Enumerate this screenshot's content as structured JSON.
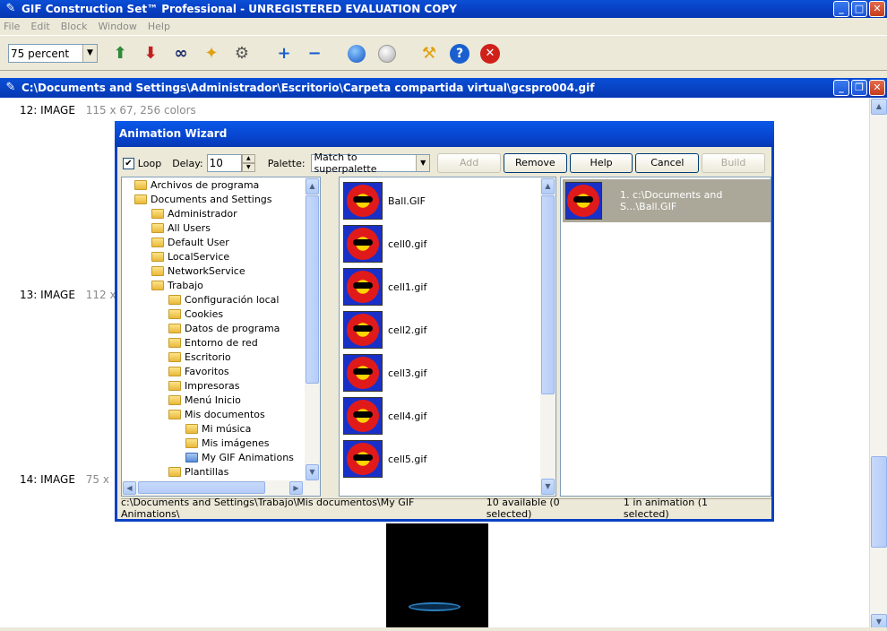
{
  "app": {
    "title": "GIF Construction Set™ Professional - UNREGISTERED EVALUATION COPY"
  },
  "menu": [
    "File",
    "Edit",
    "Block",
    "Window",
    "Help"
  ],
  "toolbar": {
    "zoom_value": "75 percent",
    "icons": [
      "insert-icon",
      "export-icon",
      "binoculars-icon",
      "wand-icon",
      "gear-icon",
      "zoom-in-icon",
      "zoom-out-icon",
      "play-icon",
      "stop-icon",
      "wrench-icon",
      "help-icon",
      "close-icon"
    ]
  },
  "document": {
    "title": "C:\\Documents and Settings\\Administrador\\Escritorio\\Carpeta compartida virtual\\gcspro004.gif",
    "blocks": [
      {
        "label": "12: IMAGE",
        "info": "115 x 67, 256 colors"
      },
      {
        "label": "13: IMAGE",
        "info": "112 x"
      },
      {
        "label": "14: IMAGE",
        "info": "75 x"
      }
    ]
  },
  "wizard": {
    "title": "Animation Wizard",
    "loop_label": "Loop",
    "loop_checked": true,
    "delay_label": "Delay:",
    "delay_value": "10",
    "palette_label": "Palette:",
    "palette_value": "Match to superpalette",
    "buttons": {
      "add": "Add",
      "remove": "Remove",
      "help": "Help",
      "cancel": "Cancel",
      "build": "Build"
    },
    "tree": [
      {
        "label": "Archivos de programa",
        "depth": 0
      },
      {
        "label": "Documents and Settings",
        "depth": 0
      },
      {
        "label": "Administrador",
        "depth": 1
      },
      {
        "label": "All Users",
        "depth": 1
      },
      {
        "label": "Default User",
        "depth": 1
      },
      {
        "label": "LocalService",
        "depth": 1
      },
      {
        "label": "NetworkService",
        "depth": 1
      },
      {
        "label": "Trabajo",
        "depth": 1
      },
      {
        "label": "Configuración local",
        "depth": 2
      },
      {
        "label": "Cookies",
        "depth": 2
      },
      {
        "label": "Datos de programa",
        "depth": 2
      },
      {
        "label": "Entorno de red",
        "depth": 2
      },
      {
        "label": "Escritorio",
        "depth": 2
      },
      {
        "label": "Favoritos",
        "depth": 2
      },
      {
        "label": "Impresoras",
        "depth": 2
      },
      {
        "label": "Menú Inicio",
        "depth": 2
      },
      {
        "label": "Mis documentos",
        "depth": 2
      },
      {
        "label": "Mi música",
        "depth": 3
      },
      {
        "label": "Mis imágenes",
        "depth": 3
      },
      {
        "label": "My GIF Animations",
        "depth": 3,
        "open": true
      },
      {
        "label": "Plantillas",
        "depth": 2
      }
    ],
    "files": [
      "Ball.GIF",
      "cell0.gif",
      "cell1.gif",
      "cell2.gif",
      "cell3.gif",
      "cell4.gif",
      "cell5.gif"
    ],
    "animation": [
      "1. c:\\Documents and S...\\Ball.GIF"
    ],
    "status": {
      "path": "c:\\Documents and Settings\\Trabajo\\Mis documentos\\My GIF Animations\\",
      "available": "10 available (0 selected)",
      "in_animation": "1 in animation (1 selected)"
    }
  }
}
